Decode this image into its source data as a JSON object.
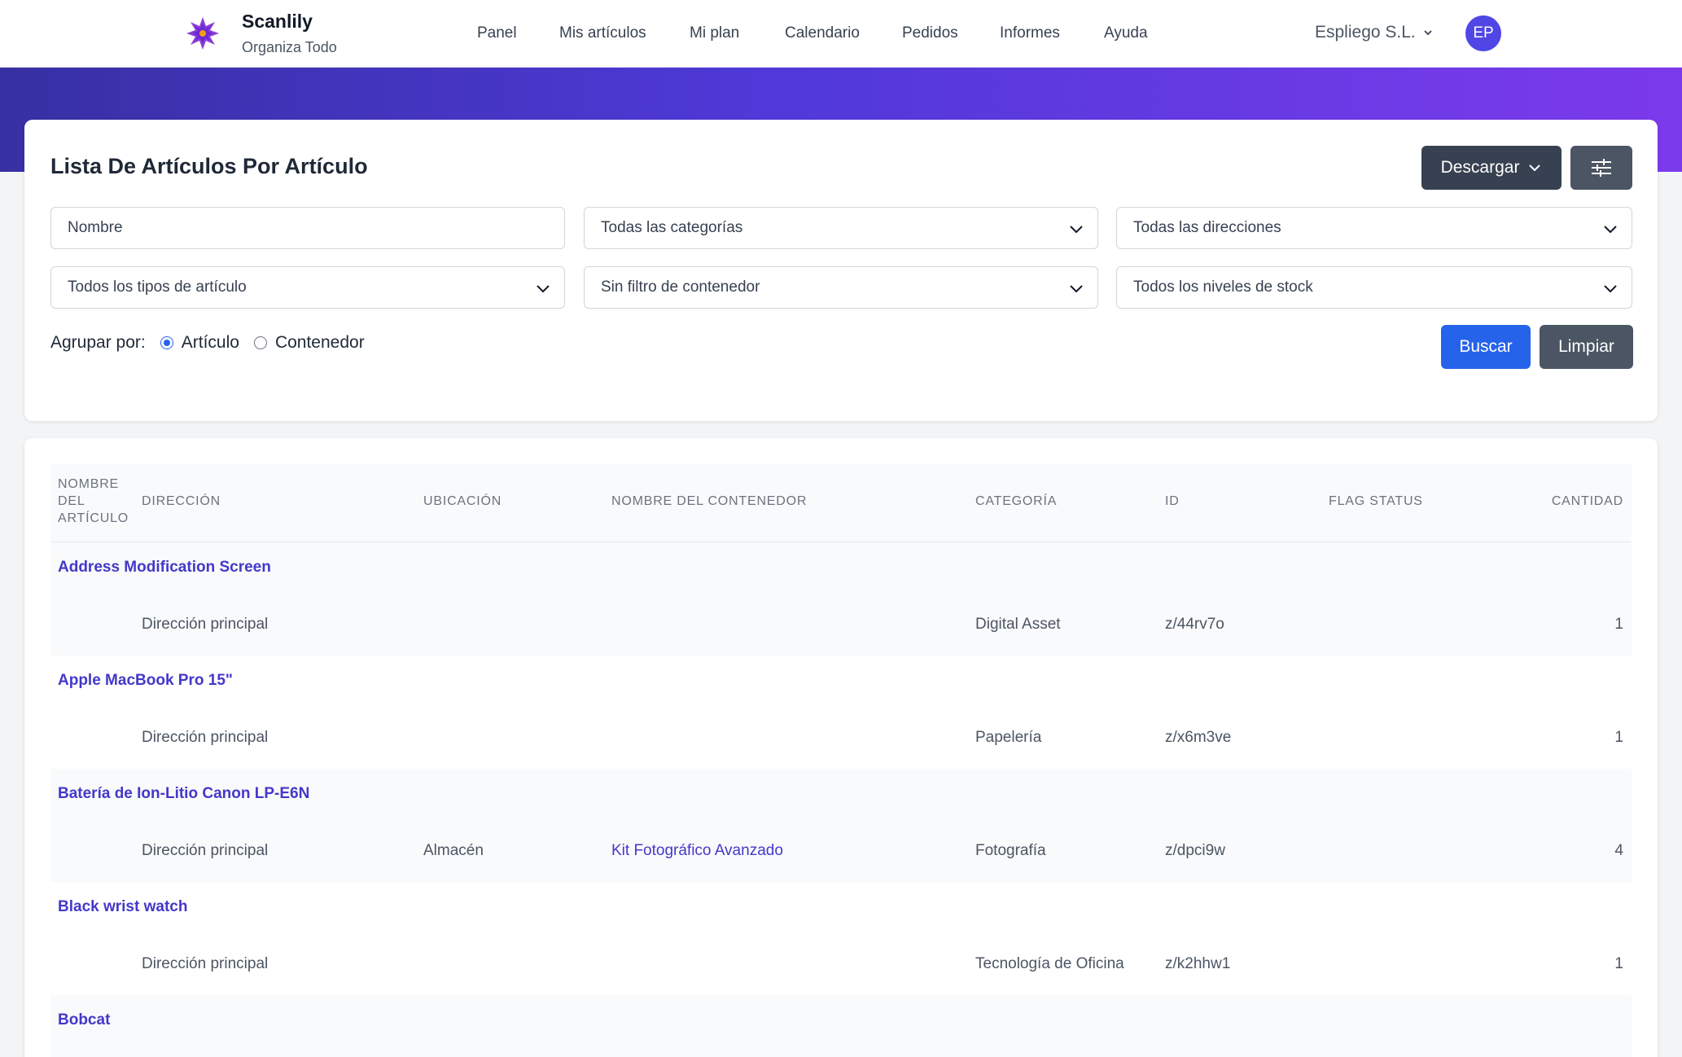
{
  "brand": {
    "name": "Scanlily",
    "tagline": "Organiza Todo"
  },
  "nav": [
    "Panel",
    "Mis artículos",
    "Mi plan",
    "Calendario",
    "Pedidos",
    "Informes",
    "Ayuda"
  ],
  "account": {
    "org": "Espliego S.L.",
    "initials": "EP"
  },
  "page": {
    "title": "Lista De Artículos Por Artículo"
  },
  "actions": {
    "download_label": "Descargar",
    "search_label": "Buscar",
    "clear_label": "Limpiar"
  },
  "filters": {
    "name_placeholder": "Nombre",
    "category": "Todas las categorías",
    "address": "Todas las direcciones",
    "item_type": "Todos los tipos de artículo",
    "container": "Sin filtro de contenedor",
    "stock_level": "Todos los niveles de stock"
  },
  "group_by": {
    "label": "Agrupar por:",
    "options": [
      "Artículo",
      "Contenedor"
    ],
    "selected": "Artículo"
  },
  "table": {
    "headers": {
      "name": [
        "NOMBRE",
        "DEL",
        "ARTÍCULO"
      ],
      "address": "DIRECCIÓN",
      "location": "UBICACIÓN",
      "container": "NOMBRE DEL CONTENEDOR",
      "category": "CATEGORÍA",
      "id": "ID",
      "flag": "FLAG STATUS",
      "qty": "CANTIDAD"
    },
    "rows": [
      {
        "name": "Address Modification Screen",
        "address": "Dirección principal",
        "location": "",
        "container": "",
        "category": "Digital Asset",
        "id": "z/44rv7o",
        "flag": "",
        "qty": "1"
      },
      {
        "name": "Apple MacBook Pro 15\"",
        "address": "Dirección principal",
        "location": "",
        "container": "",
        "category": "Papelería",
        "id": "z/x6m3ve",
        "flag": "",
        "qty": "1"
      },
      {
        "name": "Batería de Ion-Litio Canon LP-E6N",
        "address": "Dirección principal",
        "location": "Almacén",
        "container": "Kit Fotográfico Avanzado",
        "category": "Fotografía",
        "id": "z/dpci9w",
        "flag": "",
        "qty": "4"
      },
      {
        "name": "Black wrist watch",
        "address": "Dirección principal",
        "location": "",
        "container": "",
        "category": "Tecnología de Oficina",
        "id": "z/k2hhw1",
        "flag": "",
        "qty": "1"
      },
      {
        "name": "Bobcat",
        "address": "",
        "location": "",
        "container": "",
        "category": "",
        "id": "",
        "flag": "",
        "qty": ""
      }
    ]
  },
  "colors": {
    "accent": "#4338ca",
    "primary_button": "#2563eb",
    "dark_button": "#374151",
    "hero_start": "#3730a3",
    "hero_end": "#7c3aed"
  }
}
